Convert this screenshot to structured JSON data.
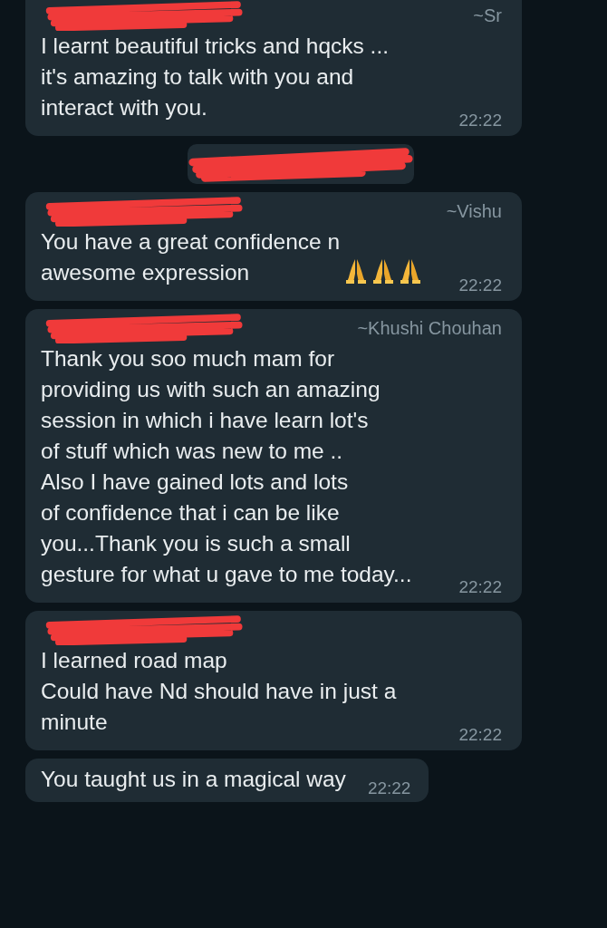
{
  "messages": [
    {
      "kind": "message",
      "redacted_sender": true,
      "push_name": "~Sr",
      "text": "I learnt beautiful tricks and hqcks ...\nit's amazing to talk with you and\ninteract with you.",
      "time": "22:22"
    },
    {
      "kind": "system",
      "redacted_sender": true
    },
    {
      "kind": "message",
      "redacted_sender": true,
      "push_name": "~Vishu",
      "text": "You have a great confidence n\nawesome expression",
      "icons": [
        {
          "kind": "folded-hands"
        },
        {
          "kind": "folded-hands"
        },
        {
          "kind": "folded-hands"
        }
      ],
      "time": "22:22"
    },
    {
      "kind": "message",
      "redacted_sender": true,
      "push_name": "~Khushi Chouhan",
      "text": "Thank you soo much mam for\nproviding us with such an amazing\nsession in which i have learn lot's\nof stuff which was new to me ..\nAlso I have  gained lots and lots\nof confidence that i can be like\nyou...Thank you is such a small\ngesture for what u gave to me today...",
      "time": "22:22"
    },
    {
      "kind": "message",
      "redacted_sender": true,
      "text": "I learned road map\nCould have Nd should have in just a\nminute",
      "time": "22:22"
    },
    {
      "kind": "message",
      "redacted_sender": false,
      "text": "You taught us in a magical way",
      "time": "22:22",
      "inline_time": true
    }
  ]
}
